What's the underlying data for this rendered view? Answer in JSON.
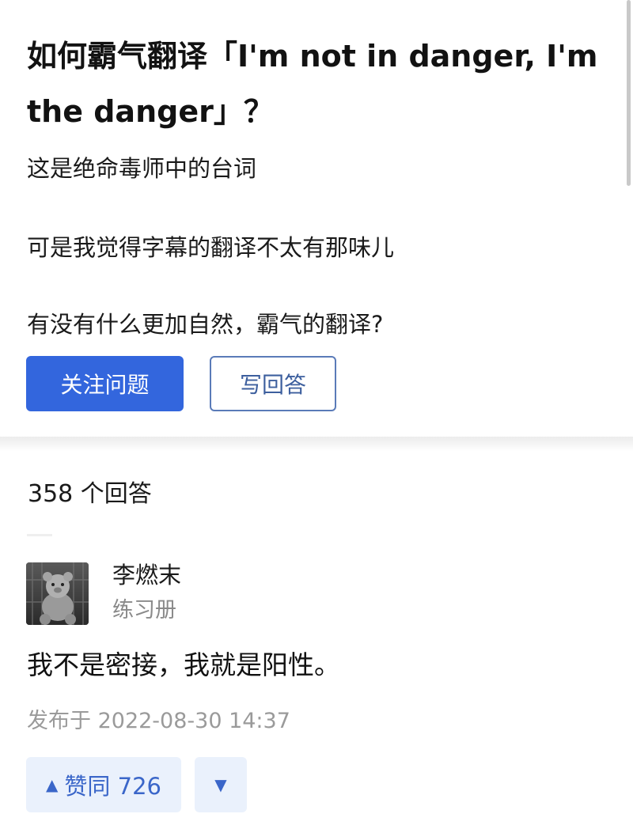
{
  "question": {
    "title": "如何霸气翻译「I'm not in danger, I'm the danger」？",
    "detail_lines": [
      "这是绝命毒师中的台词",
      "可是我觉得字幕的翻译不太有那味儿",
      "有没有什么更加自然，霸气的翻译?"
    ],
    "follow_label": "关注问题",
    "write_answer_label": "写回答"
  },
  "answers_header": {
    "count_label": "358 个回答"
  },
  "answer": {
    "author_name": "李燃末",
    "author_bio": "练习册",
    "content": "我不是密接，我就是阳性。",
    "publish_time": "发布于 2022-08-30 14:37",
    "upvote_icon": "▲",
    "upvote_label": "赞同 726",
    "downvote_icon": "▼"
  },
  "colors": {
    "primary_blue": "#3366dd",
    "vote_bg": "#eaf1fc",
    "vote_text": "#3a66c9"
  },
  "icons": {
    "upvote": "triangle-up-icon",
    "downvote": "triangle-down-icon",
    "avatar": "teddy-bear-avatar"
  }
}
